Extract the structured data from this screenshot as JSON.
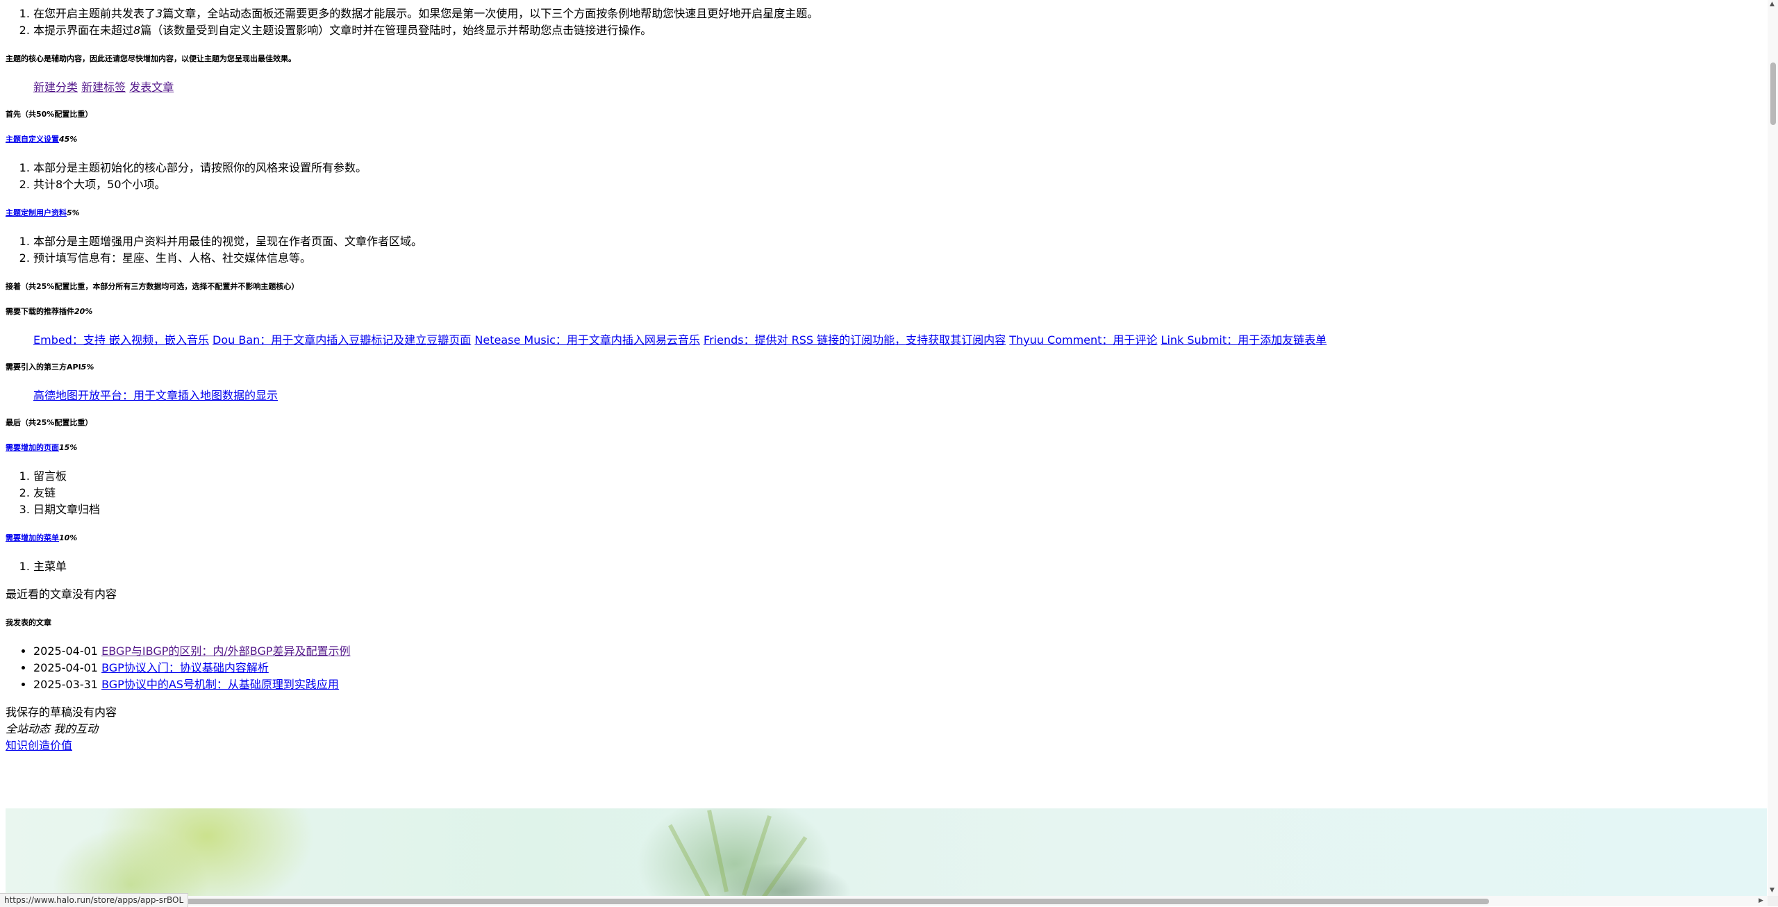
{
  "intro": {
    "items": [
      {
        "pre": "在您开启主题前共发表了",
        "num": "3",
        "post": "篇文章，全站动态面板还需要更多的数据才能展示。如果您是第一次使用，以下三个方面按条例地帮助您快速且更好地开启星度主题。"
      },
      {
        "pre": "本提示界面在未超过",
        "num": "8",
        "post": "篇（该数量受到自定义主题设置影响）文章时并在管理员登陆时，始终显示并帮助您点击链接进行操作。"
      }
    ]
  },
  "core_heading": "主题的核心是辅助内容，因此还请您尽快增加内容，以便让主题为您呈现出最佳效果。",
  "quick_links": [
    "新建分类",
    "新建标签",
    "发表文章"
  ],
  "section_first": {
    "heading": "首先（共50%配置比重）",
    "theme_settings": {
      "link": "主题自定义设置",
      "weight": "45%",
      "items": [
        "本部分是主题初始化的核心部分，请按照你的风格来设置所有参数。",
        "共计8个大项，50个小项。"
      ]
    },
    "user_profile": {
      "link": "主题定制用户资料",
      "weight": "5%",
      "items": [
        "本部分是主题增强用户资料并用最佳的视觉，呈现在作者页面、文章作者区域。",
        "预计填写信息有：星座、生肖、人格、社交媒体信息等。"
      ]
    }
  },
  "section_next": {
    "heading": "接着（共25%配置比重，本部分所有三方数据均可选，选择不配置并不影响主题核心）",
    "plugins": {
      "label": "需要下载的推荐插件",
      "weight": "20%",
      "links": [
        "Embed：支持 嵌入视频，嵌入音乐",
        "Dou Ban：用于文章内插入豆瓣标记及建立豆瓣页面",
        "Netease Music：用于文章内插入网易云音乐",
        "Friends：提供对 RSS 链接的订阅功能，支持获取其订阅内容",
        "Thyuu Comment：用于评论",
        "Link Submit：用于添加友链表单"
      ]
    },
    "api": {
      "label": "需要引入的第三方API",
      "weight": "5%",
      "links": [
        "高德地图开放平台：用于文章插入地图数据的显示"
      ]
    }
  },
  "section_last": {
    "heading": "最后（共25%配置比重）",
    "pages": {
      "link": "需要增加的页面",
      "weight": "15%",
      "items": [
        "留言板",
        "友链",
        "日期文章归档"
      ]
    },
    "menus": {
      "link": "需要增加的菜单",
      "weight": "10%",
      "items": [
        "主菜单"
      ]
    }
  },
  "recent_empty": "最近看的文章没有内容",
  "my_posts": {
    "heading": "我发表的文章",
    "items": [
      {
        "date": "2025-04-01",
        "title": "EBGP与IBGP的区别：内/外部BGP差异及配置示例"
      },
      {
        "date": "2025-04-01",
        "title": "BGP协议入门：协议基础内容解析"
      },
      {
        "date": "2025-03-31",
        "title": "BGP协议中的AS号机制：从基础原理到实践应用"
      }
    ]
  },
  "drafts_empty": "我保存的草稿没有内容",
  "tabs": {
    "site": "全站动态",
    "mine": "我的互动"
  },
  "slogan": "知识创造价值",
  "status_url": "https://www.halo.run/store/apps/app-srBOL",
  "colors": {
    "link": "#0000ee",
    "visited": "#551a8b"
  }
}
